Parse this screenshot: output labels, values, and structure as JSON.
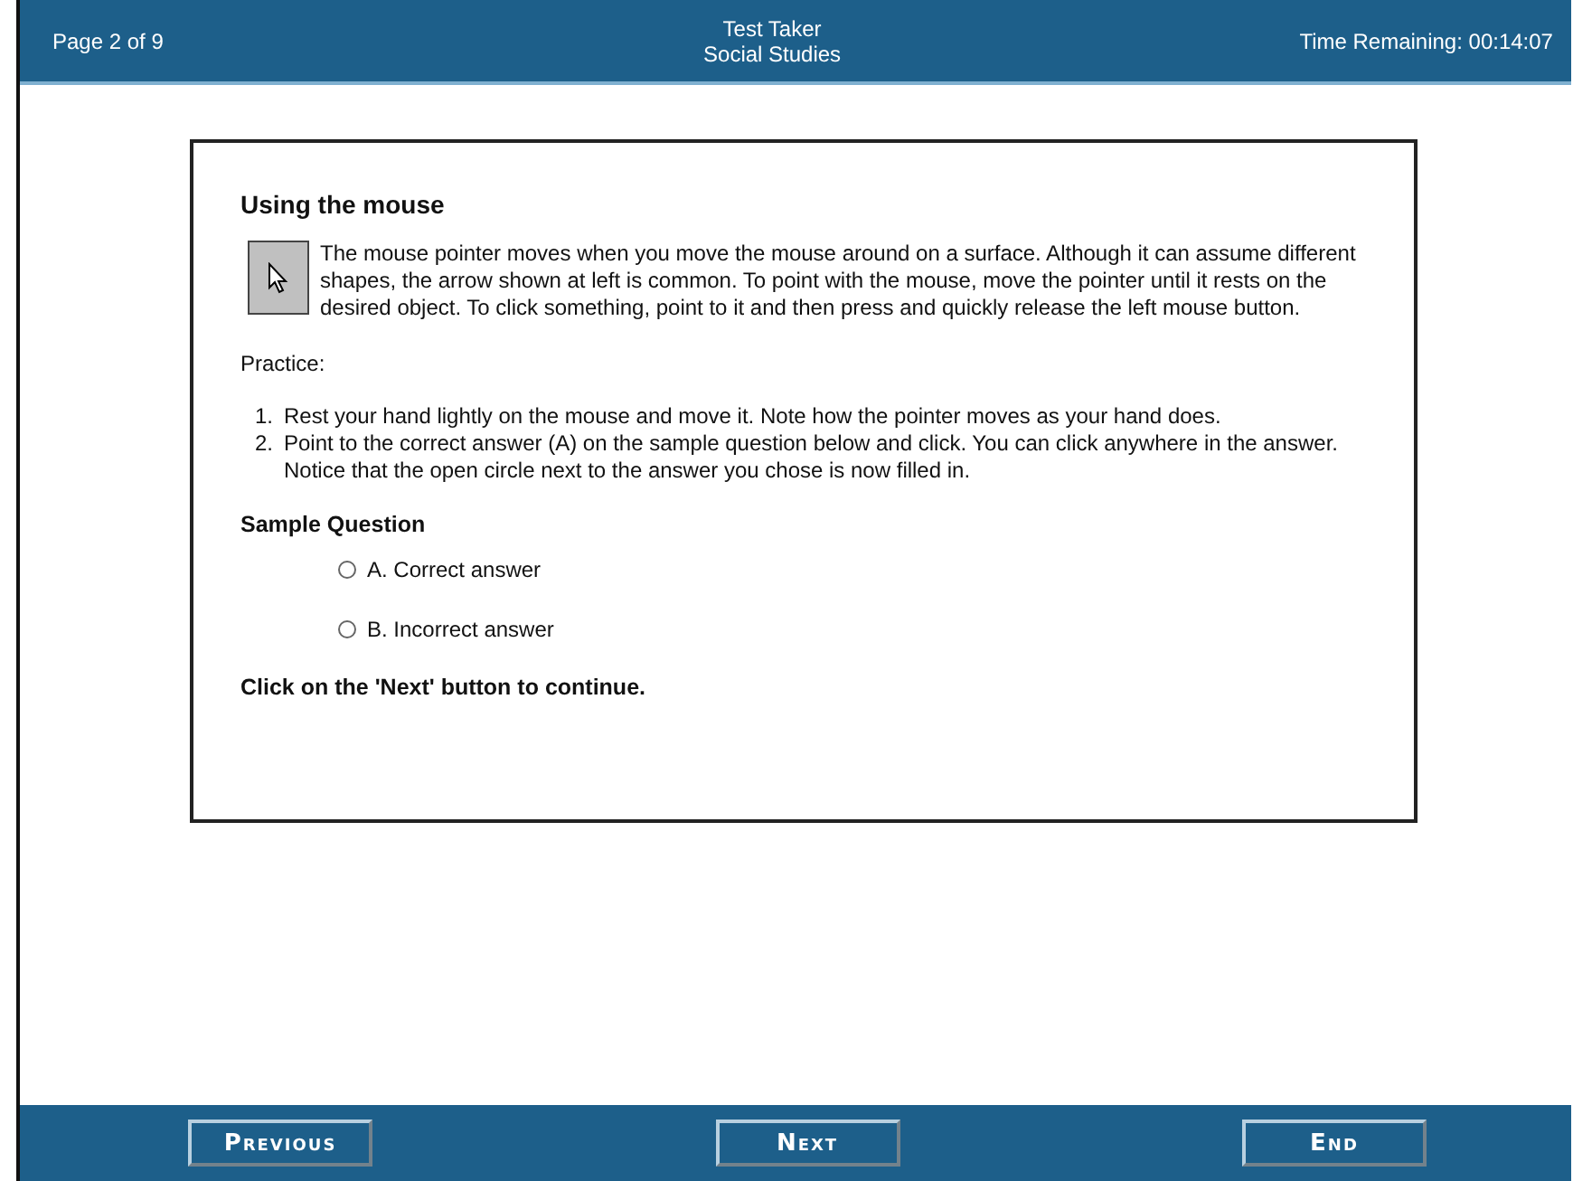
{
  "header": {
    "page": "Page 2 of 9",
    "user": "Test Taker",
    "subject": "Social Studies",
    "timer": "Time Remaining: 00:14:07"
  },
  "lesson": {
    "title": "Using the mouse",
    "intro": "The mouse pointer moves when you move the mouse around on a surface.  Although it can assume different shapes, the arrow shown at left is common.  To point with the mouse, move the pointer until it rests on the desired object.  To click something, point to it and then press and quickly release the left mouse button.",
    "practice_label": "Practice:",
    "steps": [
      {
        "number": "1.",
        "text": "Rest your hand lightly on the mouse and move it.  Note how the pointer moves as your hand does."
      },
      {
        "number": "2.",
        "text": "Point to the correct answer (A) on the sample question below and click.  You can click anywhere in the answer.  Notice that the open circle next to the answer you chose is now filled in."
      }
    ],
    "question_title": "Sample Question",
    "options": [
      {
        "label": "A. Correct answer",
        "selected": false
      },
      {
        "label": "B. Incorrect answer",
        "selected": false
      }
    ],
    "footer_note": "Click on the 'Next' button to continue."
  },
  "buttons": [
    "Previous",
    "Next",
    "End"
  ]
}
